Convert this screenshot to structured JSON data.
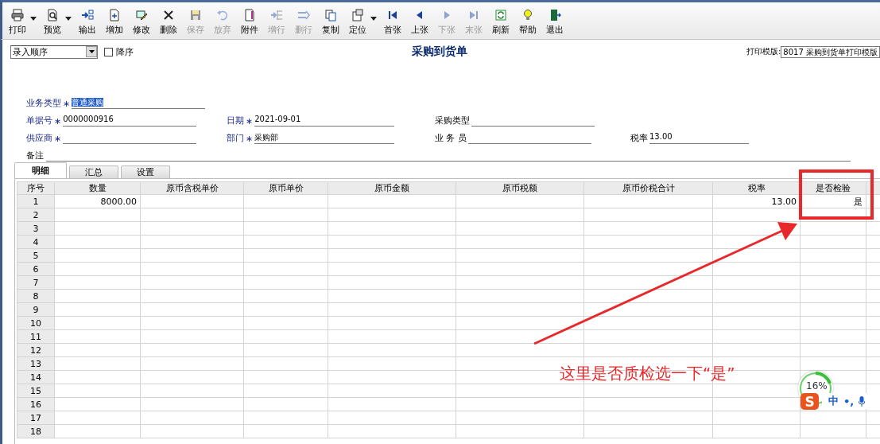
{
  "toolbar": [
    {
      "label": "打印",
      "dropdown": true,
      "disabled": false
    },
    {
      "label": "预览",
      "dropdown": true,
      "disabled": false
    },
    {
      "label": "输出",
      "dropdown": false,
      "disabled": false
    },
    {
      "label": "增加",
      "dropdown": false,
      "disabled": false
    },
    {
      "label": "修改",
      "dropdown": false,
      "disabled": false
    },
    {
      "label": "删除",
      "dropdown": false,
      "disabled": false
    },
    {
      "label": "保存",
      "dropdown": false,
      "disabled": true
    },
    {
      "label": "放弃",
      "dropdown": false,
      "disabled": true
    },
    {
      "label": "附件",
      "dropdown": false,
      "disabled": false
    },
    {
      "label": "增行",
      "dropdown": false,
      "disabled": true
    },
    {
      "label": "删行",
      "dropdown": false,
      "disabled": true
    },
    {
      "label": "复制",
      "dropdown": false,
      "disabled": false
    },
    {
      "label": "定位",
      "dropdown": true,
      "disabled": false
    },
    {
      "label": "首张",
      "dropdown": false,
      "disabled": false
    },
    {
      "label": "上张",
      "dropdown": false,
      "disabled": false
    },
    {
      "label": "下张",
      "dropdown": false,
      "disabled": true
    },
    {
      "label": "末张",
      "dropdown": false,
      "disabled": true
    },
    {
      "label": "刷新",
      "dropdown": false,
      "disabled": false
    },
    {
      "label": "帮助",
      "dropdown": false,
      "disabled": false
    },
    {
      "label": "退出",
      "dropdown": false,
      "disabled": false
    }
  ],
  "order_select": {
    "value": "录入顺序"
  },
  "descending": {
    "label": "降序",
    "checked": false
  },
  "title": "采购到货单",
  "print_template": {
    "label": "打印模版:",
    "value": "8017 采购到货单打印模版"
  },
  "form": {
    "rows": [
      [
        {
          "label": "业务类型",
          "mark": "∗",
          "value": "普通采购",
          "selected": true
        },
        null,
        null,
        null
      ],
      [
        {
          "label": "单据号",
          "mark": "∗",
          "value": "0000000916",
          "selected": false
        },
        {
          "label": "日期",
          "mark": "∗",
          "value": "2021-09-01",
          "selected": false
        },
        {
          "label": "采购类型",
          "selected": false
        },
        null
      ],
      [
        {
          "label": "供应商",
          "mark": "∗",
          "selected": false
        },
        {
          "label": "部门",
          "mark": "∗",
          "value": "采购部",
          "selected": false
        },
        {
          "label": "业 务 员",
          "selected": false
        },
        {
          "label": "税率",
          "value": "13.00",
          "selected": false
        }
      ]
    ],
    "note": {
      "label": "备注"
    }
  },
  "tabs": [
    {
      "label": "明细",
      "selected": true
    },
    {
      "label": "汇总",
      "selected": false
    },
    {
      "label": "设置",
      "selected": false
    }
  ],
  "grid": {
    "columns": [
      {
        "label": "序号"
      },
      {
        "label": "数量"
      },
      {
        "label": "原币含税单价"
      },
      {
        "label": "原币单价"
      },
      {
        "label": "原币金额"
      },
      {
        "label": "原币税额"
      },
      {
        "label": "原币价税合计"
      },
      {
        "label": "税率"
      },
      {
        "label": "是否检验"
      }
    ],
    "rows": [
      {
        "no": "1",
        "cells": [
          {
            "text": "8000.00"
          },
          {},
          {},
          {},
          {},
          {},
          {
            "text": "13.00"
          },
          {
            "text": "是"
          }
        ]
      },
      {
        "no": "2"
      },
      {
        "no": "3"
      },
      {
        "no": "4"
      },
      {
        "no": "5"
      },
      {
        "no": "6"
      },
      {
        "no": "7"
      },
      {
        "no": "8"
      },
      {
        "no": "9"
      },
      {
        "no": "10"
      },
      {
        "no": "11"
      },
      {
        "no": "12"
      },
      {
        "no": "13"
      },
      {
        "no": "14"
      },
      {
        "no": "15"
      },
      {
        "no": "16"
      },
      {
        "no": "17"
      },
      {
        "no": "18"
      }
    ]
  },
  "annotation": {
    "text": "这里是否质检选一下“是”"
  },
  "ime": {
    "progress": "16%",
    "logo": "S",
    "mode": "中",
    "punct": "•,"
  }
}
